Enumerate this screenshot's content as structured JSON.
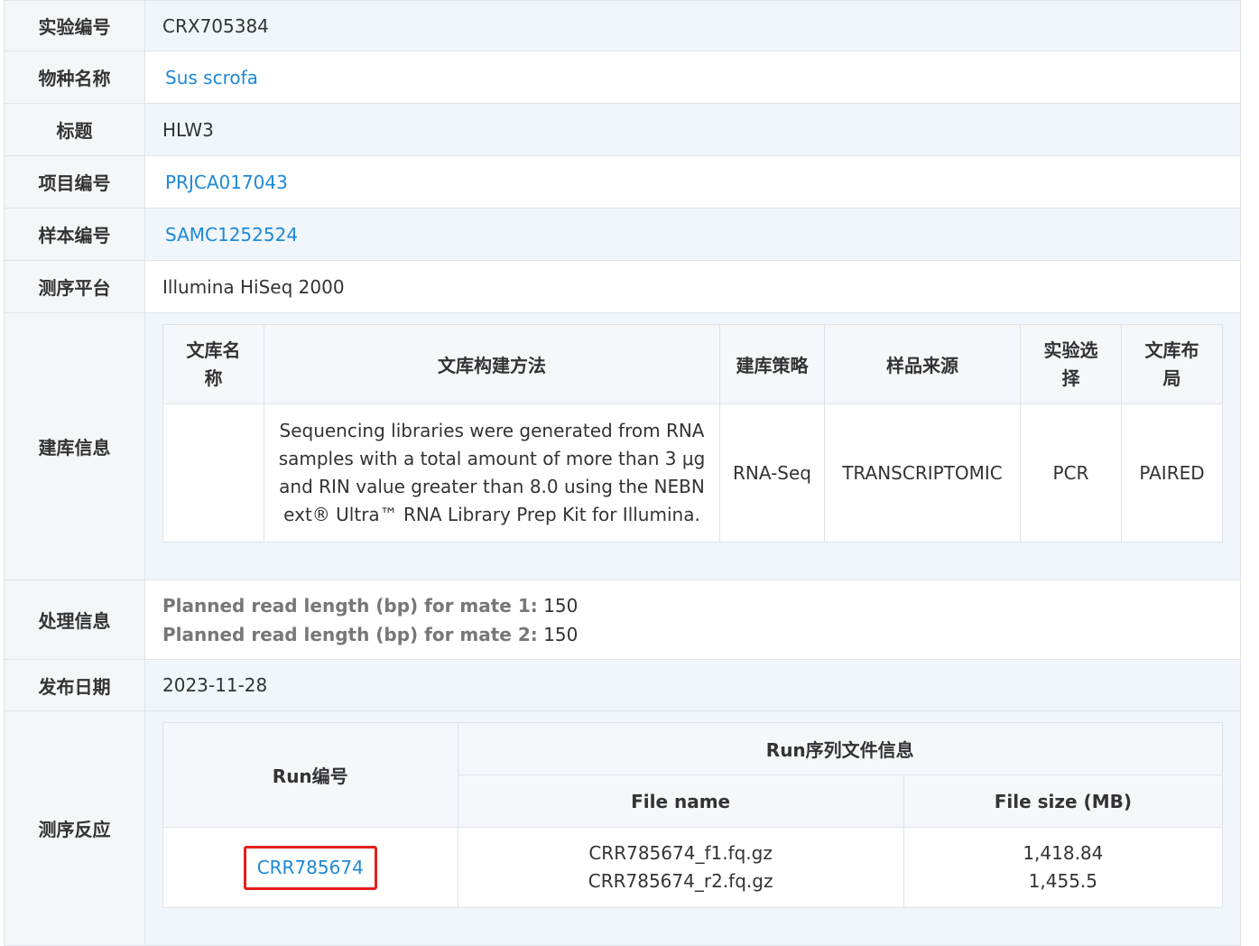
{
  "fields": {
    "experiment_id": {
      "label": "实验编号",
      "value": "CRX705384"
    },
    "species": {
      "label": "物种名称",
      "value": "Sus scrofa"
    },
    "title": {
      "label": "标题",
      "value": "HLW3"
    },
    "project_id": {
      "label": "项目编号",
      "value": "PRJCA017043"
    },
    "sample_id": {
      "label": "样本编号",
      "value": "SAMC1252524"
    },
    "platform": {
      "label": "测序平台",
      "value": "Illumina HiSeq 2000"
    },
    "library_info": {
      "label": "建库信息"
    },
    "processing_info": {
      "label": "处理信息"
    },
    "release_date": {
      "label": "发布日期",
      "value": "2023-11-28"
    },
    "sequencing_runs": {
      "label": "测序反应"
    }
  },
  "library": {
    "headers": {
      "name": "文库名称",
      "method": "文库构建方法",
      "strategy": "建库策略",
      "source": "样品来源",
      "selection": "实验选择",
      "layout": "文库布局"
    },
    "row": {
      "name": "",
      "method": "Sequencing libraries were generated from RNA samples with a total amount of more than 3 μg and RIN value greater than 8.0 using the NEBNext® Ultra™ RNA Library Prep Kit for Illumina.",
      "strategy": "RNA-Seq",
      "source": "TRANSCRIPTOMIC",
      "selection": "PCR",
      "layout": "PAIRED"
    }
  },
  "processing": {
    "mate1_label": "Planned read length (bp) for mate 1:",
    "mate1_value": "150",
    "mate2_label": "Planned read length (bp) for mate 2:",
    "mate2_value": "150"
  },
  "runs": {
    "headers": {
      "run_id": "Run编号",
      "file_info": "Run序列文件信息",
      "file_name": "File name",
      "file_size": "File size (MB)"
    },
    "row": {
      "run_id": "CRR785674",
      "file1_name": "CRR785674_f1.fq.gz",
      "file2_name": "CRR785674_r2.fq.gz",
      "file1_size": "1,418.84",
      "file2_size": "1,455.5"
    }
  },
  "colors": {
    "link": "#1e88d6",
    "highlight_border": "#e3201b",
    "label_bg": "#f4f6f8",
    "alt_row_bg": "#f0f6fb"
  }
}
